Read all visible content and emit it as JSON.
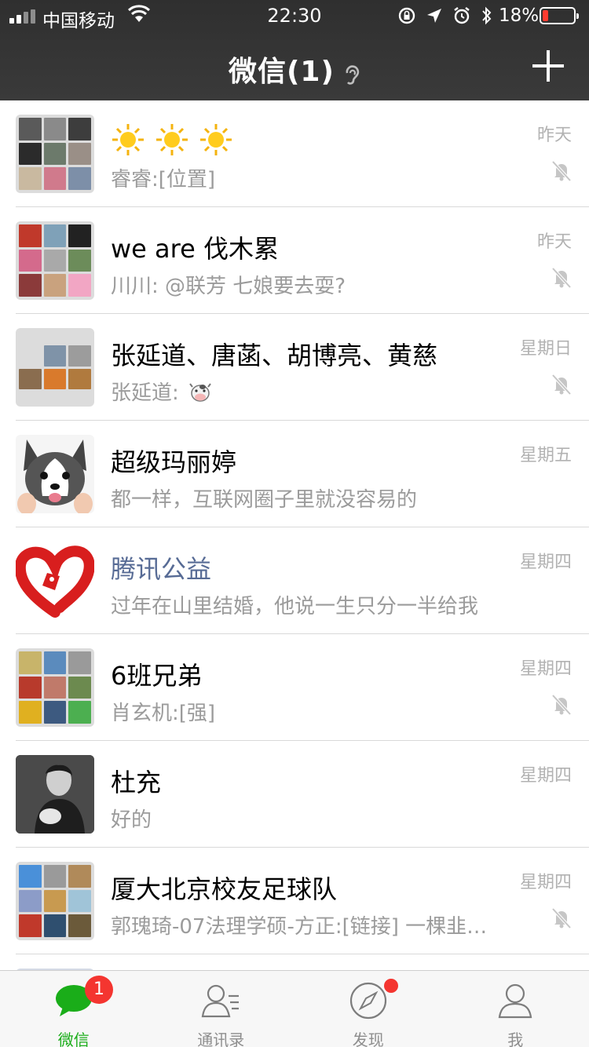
{
  "status_bar": {
    "carrier": "中国移动",
    "time": "22:30",
    "battery_percent": "18%",
    "battery_level": 0.18,
    "icons": [
      "signal-icon",
      "wifi-icon",
      "orientation-lock-icon",
      "location-icon",
      "alarm-icon",
      "bluetooth-icon",
      "battery-icon"
    ]
  },
  "nav": {
    "title": "微信(1)",
    "ear_icon": "ear-icon",
    "add_icon": "plus-icon"
  },
  "chats": [
    {
      "name": "",
      "name_emoji": [
        "sun-emoji",
        "sun-emoji",
        "sun-emoji"
      ],
      "preview": "睿睿:[位置]",
      "time": "昨天",
      "muted": true
    },
    {
      "name": "we are 伐木累",
      "preview": "川川: @联芳 七娘要去耍?",
      "time": "昨天",
      "muted": true
    },
    {
      "name": "张延道、唐菡、胡博亮、黄慈",
      "preview": "张延道: ",
      "preview_emoji": "cow-emoji",
      "time": "星期日",
      "muted": true
    },
    {
      "name": "超级玛丽婷",
      "preview": "都一样，互联网圈子里就没容易的",
      "time": "星期五",
      "muted": false
    },
    {
      "name": "腾讯公益",
      "preview": "过年在山里结婚，他说一生只分一半给我",
      "time": "星期四",
      "muted": false,
      "official": true
    },
    {
      "name": "6班兄弟",
      "preview": "肖玄机:[强]",
      "time": "星期四",
      "muted": true
    },
    {
      "name": "杜充",
      "preview": "好的",
      "time": "星期四",
      "muted": false
    },
    {
      "name": "厦大北京校友足球队",
      "preview": "郭瑰琦-07法理学硕-方正:[链接] 一棵韭…",
      "time": "星期四",
      "muted": true
    }
  ],
  "tabs": [
    {
      "label": "微信",
      "icon": "chat-bubble-icon",
      "badge": "1",
      "active": true
    },
    {
      "label": "通讯录",
      "icon": "contacts-icon",
      "active": false
    },
    {
      "label": "发现",
      "icon": "compass-icon",
      "dot": true,
      "active": false
    },
    {
      "label": "我",
      "icon": "person-icon",
      "active": false
    }
  ],
  "colors": {
    "header_bg": "#393a3e",
    "accent_green": "#1aad19",
    "badge_red": "#f43530",
    "official_name": "#576b95",
    "secondary_text": "#9b9b9b"
  }
}
